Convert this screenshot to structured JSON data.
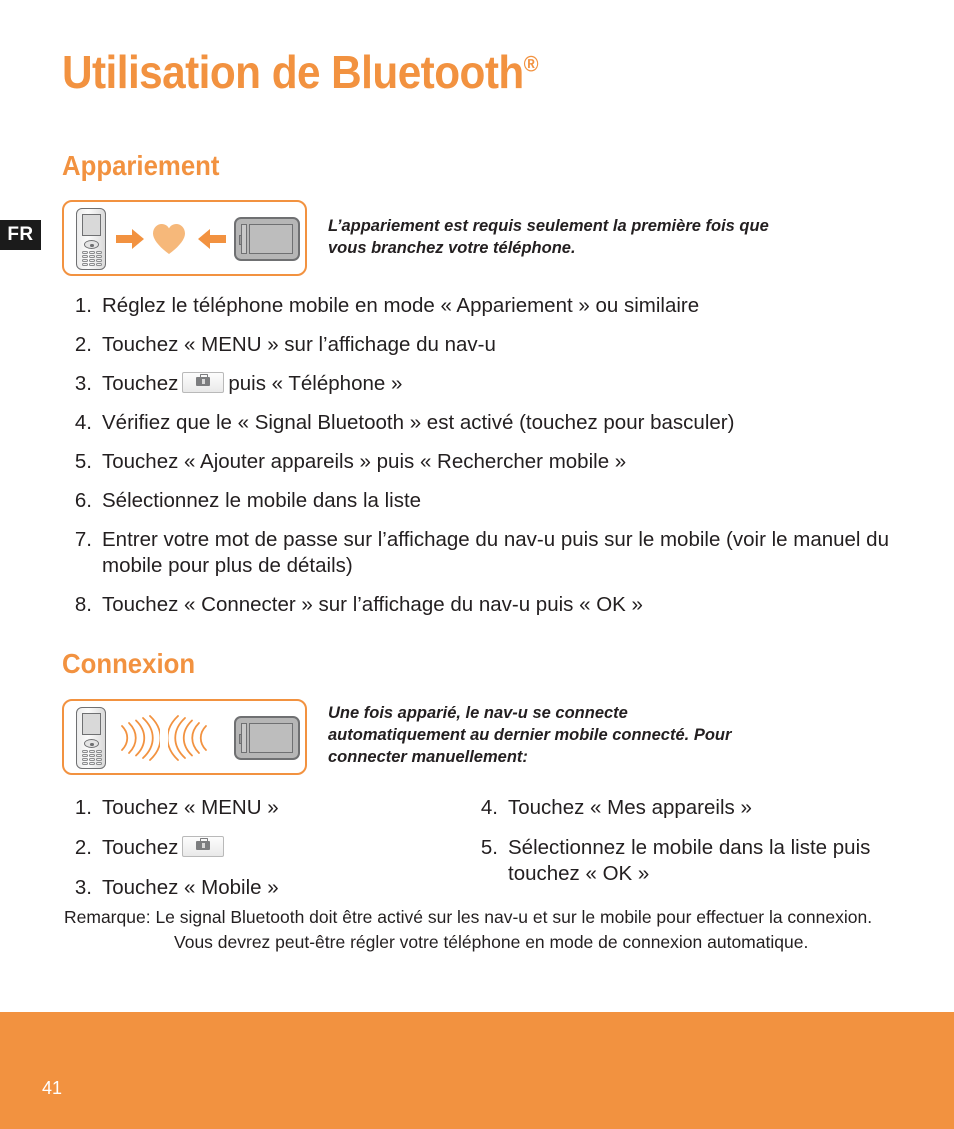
{
  "language_tab": "FR",
  "page_title": "Utilisation de Bluetooth",
  "page_title_sup": "®",
  "sections": [
    {
      "heading": "Appariement",
      "illustration": {
        "name": "pairing-illustration",
        "phone": "mobile-phone-icon",
        "target": "nav-u-device-icon",
        "symbol": "heart-icon",
        "arrows": [
          "arrow-right-icon",
          "arrow-left-icon"
        ]
      },
      "callout": "L’appariement est requis seulement la première fois que vous branchez votre téléphone.",
      "steps": [
        {
          "num": "1.",
          "text": "Réglez le téléphone mobile en mode « Appariement » ou similaire"
        },
        {
          "num": "2.",
          "text": "Touchez « MENU » sur l’affichage du nav-u"
        },
        {
          "num": "3.",
          "before": "Touchez",
          "icon": "toolbox-icon",
          "after": "puis « Téléphone »"
        },
        {
          "num": "4.",
          "text": "Vérifiez que le « Signal Bluetooth » est activé (touchez pour basculer)"
        },
        {
          "num": "5.",
          "text": "Touchez « Ajouter appareils » puis « Rechercher mobile »"
        },
        {
          "num": "6.",
          "text": "Sélectionnez le mobile dans la liste"
        },
        {
          "num": "7.",
          "text": "Entrer votre mot de passe sur l’affichage du nav-u puis sur le mobile (voir le manuel du mobile pour plus de détails)"
        },
        {
          "num": "8.",
          "text": "Touchez « Connecter » sur l’affichage du nav-u puis « OK »"
        }
      ]
    },
    {
      "heading": "Connexion",
      "illustration": {
        "name": "connection-illustration",
        "phone": "mobile-phone-icon",
        "target": "nav-u-device-icon",
        "symbol": "bluetooth-waves-icon"
      },
      "callout": "Une fois apparié, le nav-u se connecte automatiquement au dernier mobile connecté. Pour connecter manuellement:",
      "steps_left": [
        {
          "num": "1.",
          "text": "Touchez « MENU »"
        },
        {
          "num": "2.",
          "before": "Touchez",
          "icon": "toolbox-icon",
          "after": ""
        },
        {
          "num": "3.",
          "text": "Touchez « Mobile »"
        }
      ],
      "steps_right": [
        {
          "num": "4.",
          "text": "Touchez « Mes appareils »"
        },
        {
          "num": "5.",
          "text": "Sélectionnez le mobile dans la liste puis touchez « OK »"
        }
      ]
    }
  ],
  "remark": {
    "label": "Remarque:",
    "text": "Le signal Bluetooth doit être activé sur les nav-u et sur le mobile pour effectuer la connexion. Vous devrez peut-être régler votre téléphone en mode de connexion automatique."
  },
  "footer": {
    "page_number": "41"
  },
  "colors": {
    "brand_orange": "#F29240",
    "heart_orange": "#F6B87A",
    "text_black": "#231f20",
    "tab_black": "#1b1b1b"
  }
}
